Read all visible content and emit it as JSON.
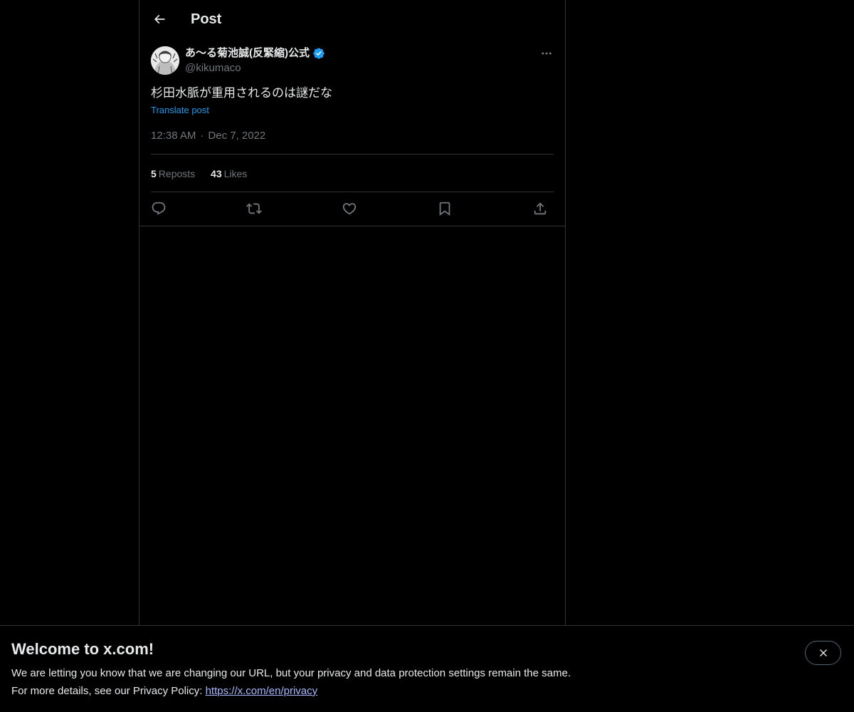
{
  "header": {
    "title": "Post",
    "back_icon": "arrow-left-icon"
  },
  "post": {
    "author": {
      "display_name": "あ〜る菊池誠(反緊縮)公式",
      "handle": "@kikumaco",
      "verified": true,
      "verified_color": "#1d9bf0"
    },
    "text": "杉田水脈が重用されるのは謎だな",
    "translate_label": "Translate post",
    "time": "12:38 AM",
    "separator": "·",
    "date": "Dec 7, 2022",
    "stats": {
      "reposts": {
        "count": "5",
        "label": "Reposts"
      },
      "likes": {
        "count": "43",
        "label": "Likes"
      }
    },
    "actions": [
      "reply-icon",
      "repost-icon",
      "like-icon",
      "bookmark-icon",
      "share-icon"
    ]
  },
  "banner": {
    "title": "Welcome to x.com!",
    "line1": "We are letting you know that we are changing our URL, but your privacy and data protection settings remain the same.",
    "line2_prefix": "For more details, see our Privacy Policy: ",
    "privacy_link": "https://x.com/en/privacy",
    "close_icon": "close-icon"
  },
  "colors": {
    "background": "#000000",
    "text": "#e7e9ea",
    "muted": "#71767b",
    "accent": "#1d9bf0",
    "border": "#2f3336",
    "link": "#a8b8ff"
  }
}
